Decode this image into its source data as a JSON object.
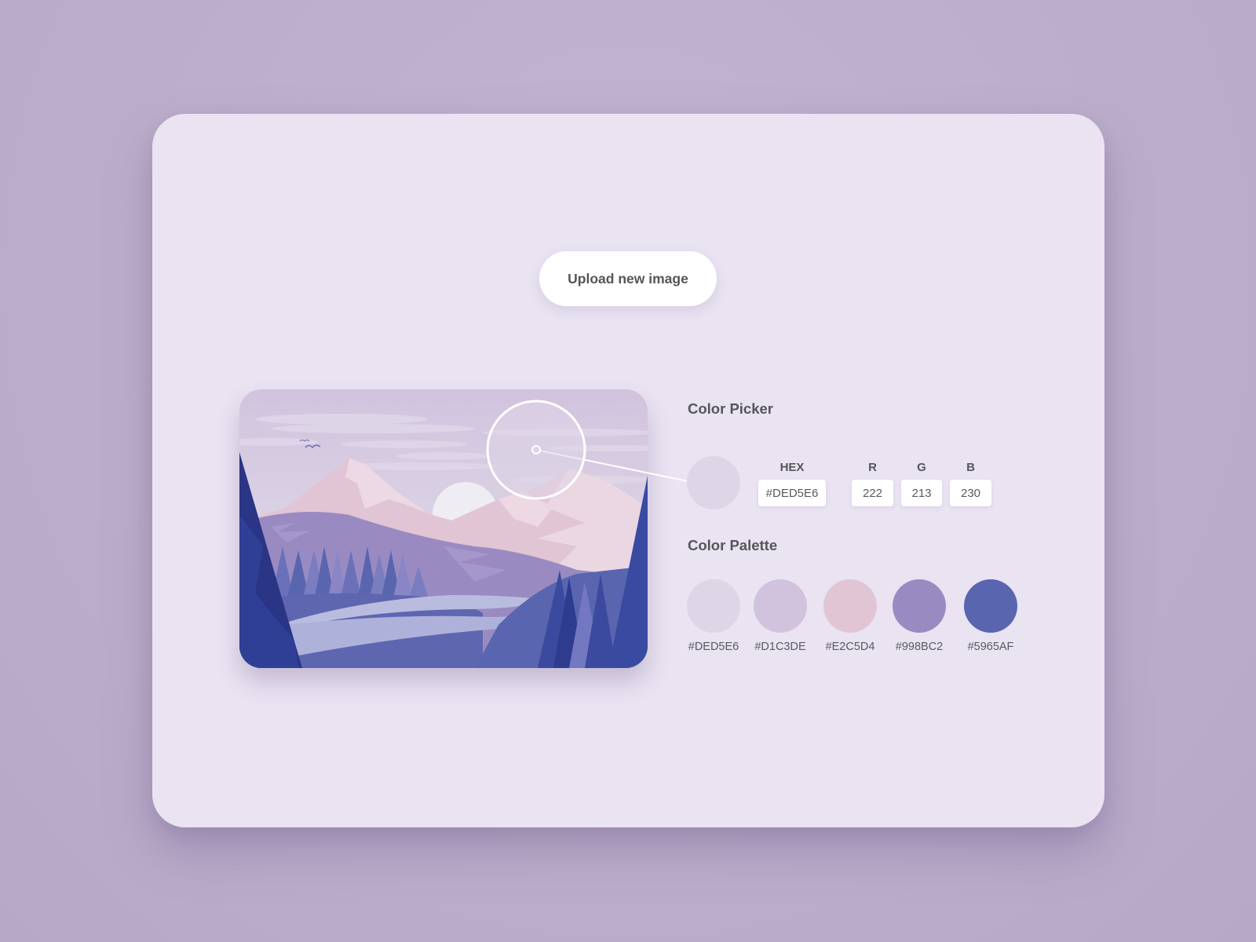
{
  "upload_button": {
    "label": "Upload new image"
  },
  "picker": {
    "title": "Color Picker",
    "selected_color": "#DED5E6",
    "hex_label": "HEX",
    "hex_value": "#DED5E6",
    "r_label": "R",
    "g_label": "G",
    "b_label": "B",
    "r_value": "222",
    "g_value": "213",
    "b_value": "230"
  },
  "palette": {
    "title": "Color Palette",
    "swatches": [
      {
        "hex": "#DED5E6",
        "label": "#DED5E6"
      },
      {
        "hex": "#D1C3DE",
        "label": "#D1C3DE"
      },
      {
        "hex": "#E2C5D4",
        "label": "#E2C5D4"
      },
      {
        "hex": "#998BC2",
        "label": "#998BC2"
      },
      {
        "hex": "#5965AF",
        "label": "#5965AF"
      }
    ]
  },
  "image": {
    "description": "Illustrated landscape of pink mountains, setting sun, purple hills, pine forest and river"
  }
}
